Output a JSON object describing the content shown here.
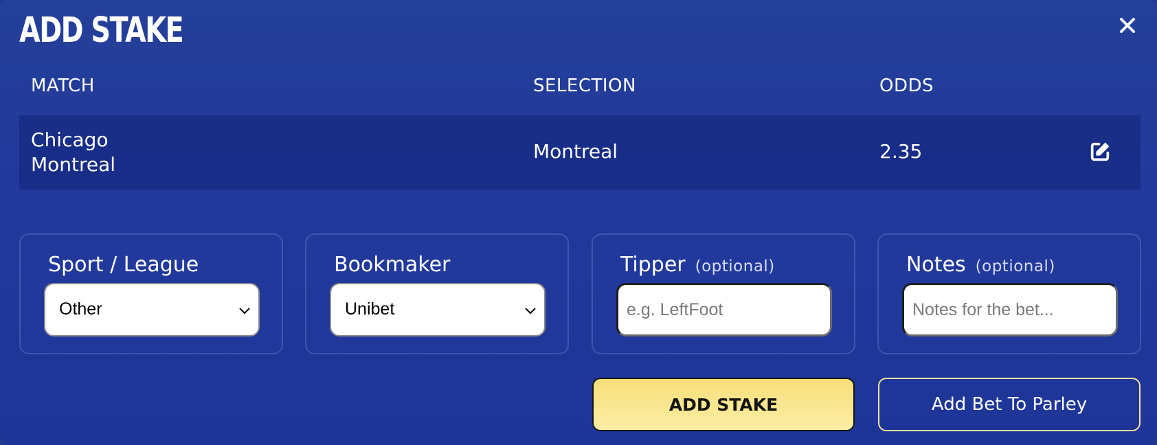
{
  "modal": {
    "title": "ADD STAKE",
    "close_icon": "close-icon"
  },
  "table": {
    "headers": [
      "MATCH",
      "SELECTION",
      "ODDS"
    ],
    "row": {
      "match_home": "Chicago",
      "match_away": "Montreal",
      "selection": "Montreal",
      "odds": "2.35",
      "edit_icon": "edit-icon"
    }
  },
  "fields": {
    "sport": {
      "label": "Sport / League",
      "value": "Other"
    },
    "bookmaker": {
      "label": "Bookmaker",
      "value": "Unibet"
    },
    "tipper": {
      "label": "Tipper",
      "optional": "(optional)",
      "placeholder": "e.g. LeftFoot",
      "value": ""
    },
    "notes": {
      "label": "Notes",
      "optional": "(optional)",
      "placeholder": "Notes for the bet...",
      "value": ""
    }
  },
  "actions": {
    "add_stake": "ADD STAKE",
    "add_to_parley": "Add Bet To Parley"
  },
  "colors": {
    "background": "#22399b",
    "primary_button": "#f9e68f",
    "secondary_border": "#f6e39a"
  }
}
